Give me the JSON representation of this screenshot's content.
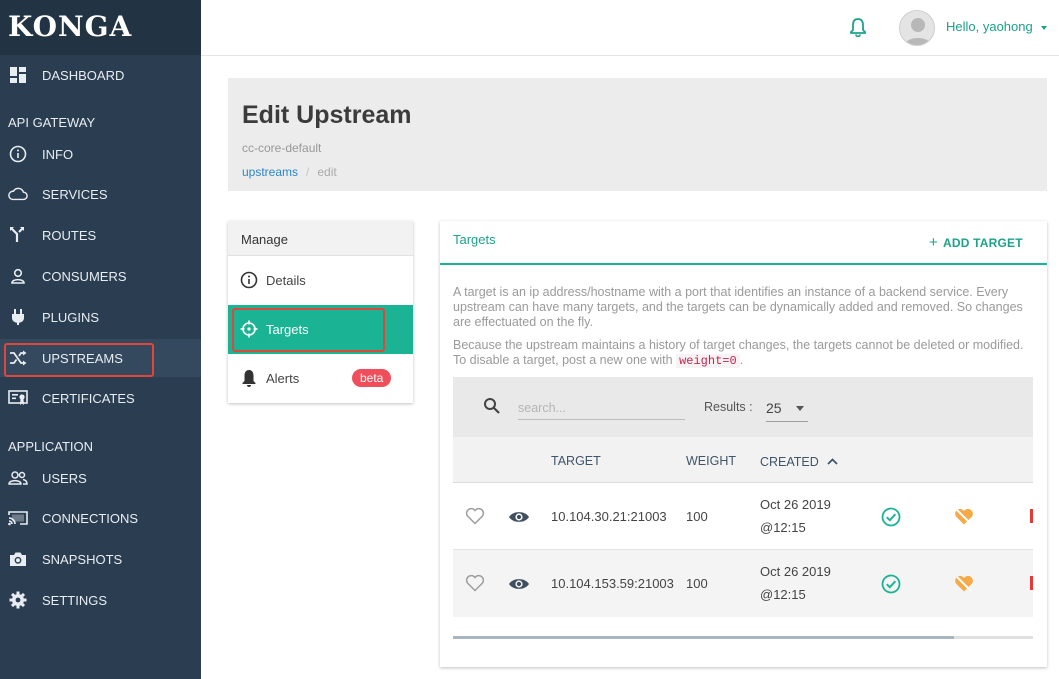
{
  "sidebar": {
    "logo": "KONGA",
    "sections": {
      "api_gateway": "API GATEWAY",
      "application": "APPLICATION"
    },
    "items": [
      {
        "label": "DASHBOARD",
        "icon": "dashboard-icon"
      },
      {
        "label": "INFO",
        "icon": "info-icon"
      },
      {
        "label": "SERVICES",
        "icon": "cloud-icon"
      },
      {
        "label": "ROUTES",
        "icon": "fork-icon"
      },
      {
        "label": "CONSUMERS",
        "icon": "person-icon"
      },
      {
        "label": "PLUGINS",
        "icon": "plug-icon"
      },
      {
        "label": "UPSTREAMS",
        "icon": "shuffle-icon",
        "active": true
      },
      {
        "label": "CERTIFICATES",
        "icon": "certificate-icon"
      },
      {
        "label": "USERS",
        "icon": "users-icon"
      },
      {
        "label": "CONNECTIONS",
        "icon": "cast-icon"
      },
      {
        "label": "SNAPSHOTS",
        "icon": "camera-icon"
      },
      {
        "label": "SETTINGS",
        "icon": "gear-icon"
      }
    ]
  },
  "topbar": {
    "greeting": "Hello, yaohong",
    "notification_icon": "bell-icon",
    "accent": "#1ba38a"
  },
  "page": {
    "title": "Edit Upstream",
    "subtitle": "cc-core-default",
    "breadcrumb": {
      "parent": "upstreams",
      "current": "edit"
    }
  },
  "manage": {
    "header": "Manage",
    "items": [
      {
        "label": "Details",
        "icon": "info-icon"
      },
      {
        "label": "Targets",
        "icon": "crosshair-icon",
        "active": true
      },
      {
        "label": "Alerts",
        "icon": "bell-icon",
        "badge": "beta"
      }
    ]
  },
  "targets": {
    "tab_label": "Targets",
    "add_label": "ADD TARGET",
    "description1": "A target is an ip address/hostname with a port that identifies an instance of a backend service. Every upstream can have many targets, and the targets can be dynamically added and removed. So changes are effectuated on the fly.",
    "description2_pre": "Because the upstream maintains a history of target changes, the targets cannot be deleted or modified. To disable a target, post a new one with",
    "description2_code": "weight=0",
    "description2_post": ".",
    "search_placeholder": "search...",
    "results_label": "Results :",
    "results_value": "25",
    "columns": {
      "target": "TARGET",
      "weight": "WEIGHT",
      "created": "CREATED"
    },
    "rows": [
      {
        "target": "10.104.30.21:21003",
        "weight": "100",
        "created_date": "Oct 26 2019",
        "created_time": "@12:15"
      },
      {
        "target": "10.104.153.59:21003",
        "weight": "100",
        "created_date": "Oct 26 2019",
        "created_time": "@12:15"
      }
    ]
  },
  "colors": {
    "sidebar_bg": "#2b3d50",
    "accent_green": "#1ab394",
    "highlight_red": "#e0463a",
    "badge_red": "#ef4e5a",
    "unhealthy_orange": "#f5a947"
  }
}
